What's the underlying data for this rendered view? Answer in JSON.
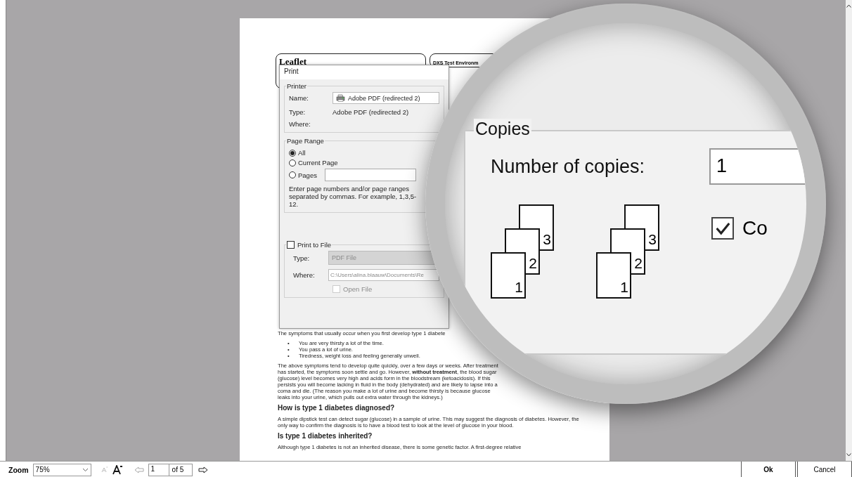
{
  "document": {
    "header_title": "Leaflet",
    "header_environment": "DXS Test Environm",
    "blocks": [
      {
        "kind": "text",
        "text": "The symptoms that usually occur when you first develop type 1 diabete"
      },
      {
        "kind": "bullets",
        "marker": "•",
        "items": [
          "You are very thirsty a lot of the time.",
          "You pass a lot of urine.",
          "Tiredness, weight loss and feeling generally unwell."
        ]
      },
      {
        "kind": "paragraph",
        "text": "The above symptoms tend to develop quite quickly, over a few days or weeks. After treatment has started, the symptoms soon settle and go. However, **without treatment**, the blood sugar (glucose) level becomes very high and acids form in the bloodstream (ketoacidosis). If this persists you will become lacking in fluid in the body (dehydrated) and are likely to lapse into a coma and die. (The reason you make a lot of urine and become thirsty is because glucose leaks into your urine, which pulls out extra water through the kidneys.)"
      },
      {
        "kind": "heading",
        "text": "How is type 1 diabetes diagnosed?"
      },
      {
        "kind": "paragraph",
        "text": "A simple dipstick test can detect sugar (glucose) in a sample of urine. This may suggest the diagnosis of diabetes. However, the only way to confirm the diagnosis is to have a blood test to look at the level of glucose in your blood."
      },
      {
        "kind": "heading",
        "text": "Is type 1 diabetes inherited?"
      },
      {
        "kind": "paragraph",
        "text": "Although type 1 diabetes is not an inherited disease, there is some genetic factor. A first-degree relative"
      }
    ]
  },
  "dialog": {
    "title": "Print",
    "printer": {
      "title": "Printer",
      "name_label": "Name:",
      "name_value": "Adobe PDF (redirected 2)",
      "type_label": "Type:",
      "type_value": "Adobe PDF (redirected 2)",
      "where_label": "Where:"
    },
    "page_range": {
      "title": "Page Range",
      "options": [
        {
          "label": "All",
          "selected": true
        },
        {
          "label": "Current Page",
          "selected": false
        },
        {
          "label": "Pages",
          "selected": false
        }
      ],
      "help": "Enter page numbers and/or page ranges separated by commas.  For example, 1,3,5-12."
    },
    "print_to_file": {
      "label": "Print to File",
      "checked": false,
      "type_label": "Type:",
      "type_value": "PDF File",
      "where_label": "Where:",
      "where_value": "C:\\Users\\alina.blaauw\\Documents\\Re",
      "open_file": {
        "label": "Open File",
        "checked": false,
        "disabled": true
      }
    }
  },
  "magnifier": {
    "group_title": "Copies",
    "copies_label": "Number of copies:",
    "copies_value": "1",
    "collate_stacks": [
      [
        "1",
        "2",
        "3"
      ],
      [
        "1",
        "2",
        "3"
      ]
    ],
    "collate": {
      "label": "Co",
      "checked": true
    }
  },
  "toolbar": {
    "zoom_label": "Zoom",
    "zoom_value": "75%",
    "page_value": "1",
    "page_total": "of 5",
    "buttons": [
      "Ok",
      "Cancel"
    ]
  }
}
